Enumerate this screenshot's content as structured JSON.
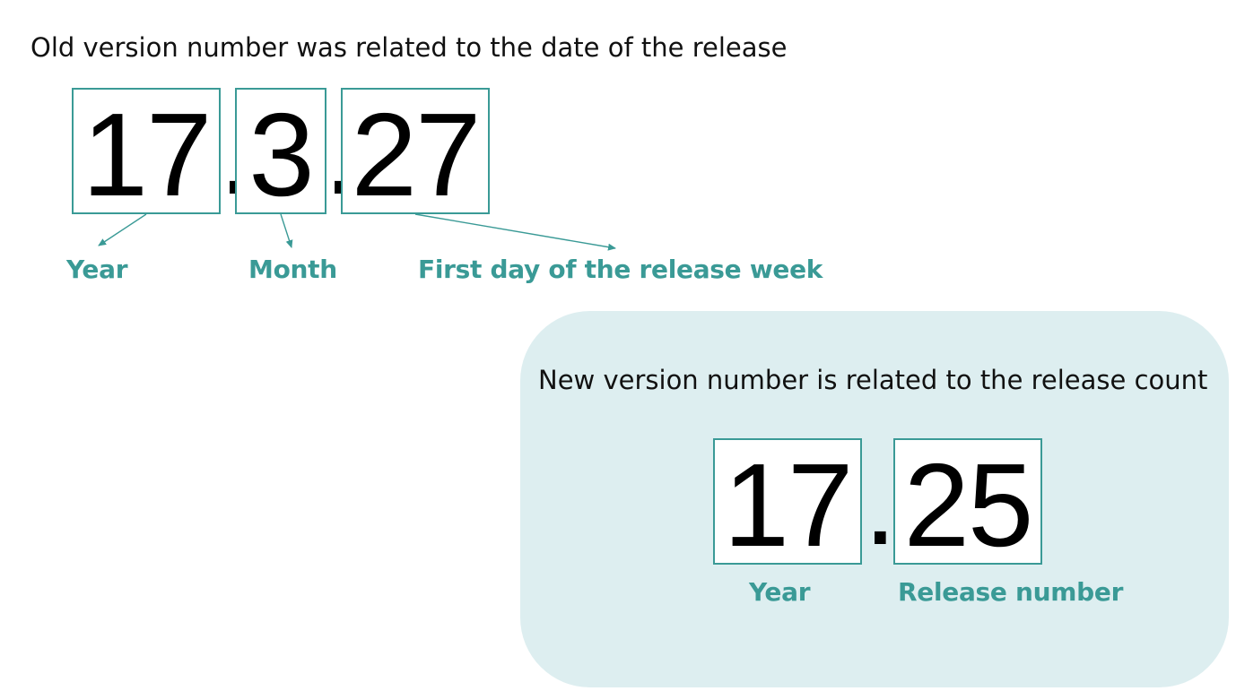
{
  "old_version": {
    "heading": "Old version number was related to the date of the release",
    "parts": [
      "17",
      "3",
      "27"
    ],
    "separator": ".",
    "labels": {
      "year": "Year",
      "month": "Month",
      "day": "First day of the release week"
    }
  },
  "new_version": {
    "heading": "New version number is related to the release count",
    "parts": [
      "17",
      "25"
    ],
    "separator": ".",
    "labels": {
      "year": "Year",
      "release": "Release number"
    }
  },
  "colors": {
    "accent": "#3a9a96",
    "panel_background": "#ddeef0",
    "digits": "#000000",
    "heading_text": "#111111"
  }
}
